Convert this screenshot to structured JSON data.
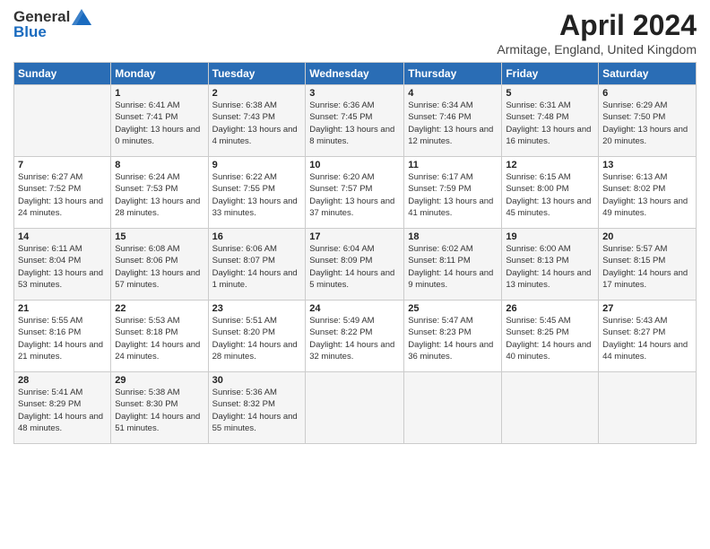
{
  "header": {
    "logo_general": "General",
    "logo_blue": "Blue",
    "month_year": "April 2024",
    "location": "Armitage, England, United Kingdom"
  },
  "days_of_week": [
    "Sunday",
    "Monday",
    "Tuesday",
    "Wednesday",
    "Thursday",
    "Friday",
    "Saturday"
  ],
  "weeks": [
    [
      {
        "day": "",
        "sunrise": "",
        "sunset": "",
        "daylight": ""
      },
      {
        "day": "1",
        "sunrise": "Sunrise: 6:41 AM",
        "sunset": "Sunset: 7:41 PM",
        "daylight": "Daylight: 13 hours and 0 minutes."
      },
      {
        "day": "2",
        "sunrise": "Sunrise: 6:38 AM",
        "sunset": "Sunset: 7:43 PM",
        "daylight": "Daylight: 13 hours and 4 minutes."
      },
      {
        "day": "3",
        "sunrise": "Sunrise: 6:36 AM",
        "sunset": "Sunset: 7:45 PM",
        "daylight": "Daylight: 13 hours and 8 minutes."
      },
      {
        "day": "4",
        "sunrise": "Sunrise: 6:34 AM",
        "sunset": "Sunset: 7:46 PM",
        "daylight": "Daylight: 13 hours and 12 minutes."
      },
      {
        "day": "5",
        "sunrise": "Sunrise: 6:31 AM",
        "sunset": "Sunset: 7:48 PM",
        "daylight": "Daylight: 13 hours and 16 minutes."
      },
      {
        "day": "6",
        "sunrise": "Sunrise: 6:29 AM",
        "sunset": "Sunset: 7:50 PM",
        "daylight": "Daylight: 13 hours and 20 minutes."
      }
    ],
    [
      {
        "day": "7",
        "sunrise": "Sunrise: 6:27 AM",
        "sunset": "Sunset: 7:52 PM",
        "daylight": "Daylight: 13 hours and 24 minutes."
      },
      {
        "day": "8",
        "sunrise": "Sunrise: 6:24 AM",
        "sunset": "Sunset: 7:53 PM",
        "daylight": "Daylight: 13 hours and 28 minutes."
      },
      {
        "day": "9",
        "sunrise": "Sunrise: 6:22 AM",
        "sunset": "Sunset: 7:55 PM",
        "daylight": "Daylight: 13 hours and 33 minutes."
      },
      {
        "day": "10",
        "sunrise": "Sunrise: 6:20 AM",
        "sunset": "Sunset: 7:57 PM",
        "daylight": "Daylight: 13 hours and 37 minutes."
      },
      {
        "day": "11",
        "sunrise": "Sunrise: 6:17 AM",
        "sunset": "Sunset: 7:59 PM",
        "daylight": "Daylight: 13 hours and 41 minutes."
      },
      {
        "day": "12",
        "sunrise": "Sunrise: 6:15 AM",
        "sunset": "Sunset: 8:00 PM",
        "daylight": "Daylight: 13 hours and 45 minutes."
      },
      {
        "day": "13",
        "sunrise": "Sunrise: 6:13 AM",
        "sunset": "Sunset: 8:02 PM",
        "daylight": "Daylight: 13 hours and 49 minutes."
      }
    ],
    [
      {
        "day": "14",
        "sunrise": "Sunrise: 6:11 AM",
        "sunset": "Sunset: 8:04 PM",
        "daylight": "Daylight: 13 hours and 53 minutes."
      },
      {
        "day": "15",
        "sunrise": "Sunrise: 6:08 AM",
        "sunset": "Sunset: 8:06 PM",
        "daylight": "Daylight: 13 hours and 57 minutes."
      },
      {
        "day": "16",
        "sunrise": "Sunrise: 6:06 AM",
        "sunset": "Sunset: 8:07 PM",
        "daylight": "Daylight: 14 hours and 1 minute."
      },
      {
        "day": "17",
        "sunrise": "Sunrise: 6:04 AM",
        "sunset": "Sunset: 8:09 PM",
        "daylight": "Daylight: 14 hours and 5 minutes."
      },
      {
        "day": "18",
        "sunrise": "Sunrise: 6:02 AM",
        "sunset": "Sunset: 8:11 PM",
        "daylight": "Daylight: 14 hours and 9 minutes."
      },
      {
        "day": "19",
        "sunrise": "Sunrise: 6:00 AM",
        "sunset": "Sunset: 8:13 PM",
        "daylight": "Daylight: 14 hours and 13 minutes."
      },
      {
        "day": "20",
        "sunrise": "Sunrise: 5:57 AM",
        "sunset": "Sunset: 8:15 PM",
        "daylight": "Daylight: 14 hours and 17 minutes."
      }
    ],
    [
      {
        "day": "21",
        "sunrise": "Sunrise: 5:55 AM",
        "sunset": "Sunset: 8:16 PM",
        "daylight": "Daylight: 14 hours and 21 minutes."
      },
      {
        "day": "22",
        "sunrise": "Sunrise: 5:53 AM",
        "sunset": "Sunset: 8:18 PM",
        "daylight": "Daylight: 14 hours and 24 minutes."
      },
      {
        "day": "23",
        "sunrise": "Sunrise: 5:51 AM",
        "sunset": "Sunset: 8:20 PM",
        "daylight": "Daylight: 14 hours and 28 minutes."
      },
      {
        "day": "24",
        "sunrise": "Sunrise: 5:49 AM",
        "sunset": "Sunset: 8:22 PM",
        "daylight": "Daylight: 14 hours and 32 minutes."
      },
      {
        "day": "25",
        "sunrise": "Sunrise: 5:47 AM",
        "sunset": "Sunset: 8:23 PM",
        "daylight": "Daylight: 14 hours and 36 minutes."
      },
      {
        "day": "26",
        "sunrise": "Sunrise: 5:45 AM",
        "sunset": "Sunset: 8:25 PM",
        "daylight": "Daylight: 14 hours and 40 minutes."
      },
      {
        "day": "27",
        "sunrise": "Sunrise: 5:43 AM",
        "sunset": "Sunset: 8:27 PM",
        "daylight": "Daylight: 14 hours and 44 minutes."
      }
    ],
    [
      {
        "day": "28",
        "sunrise": "Sunrise: 5:41 AM",
        "sunset": "Sunset: 8:29 PM",
        "daylight": "Daylight: 14 hours and 48 minutes."
      },
      {
        "day": "29",
        "sunrise": "Sunrise: 5:38 AM",
        "sunset": "Sunset: 8:30 PM",
        "daylight": "Daylight: 14 hours and 51 minutes."
      },
      {
        "day": "30",
        "sunrise": "Sunrise: 5:36 AM",
        "sunset": "Sunset: 8:32 PM",
        "daylight": "Daylight: 14 hours and 55 minutes."
      },
      {
        "day": "",
        "sunrise": "",
        "sunset": "",
        "daylight": ""
      },
      {
        "day": "",
        "sunrise": "",
        "sunset": "",
        "daylight": ""
      },
      {
        "day": "",
        "sunrise": "",
        "sunset": "",
        "daylight": ""
      },
      {
        "day": "",
        "sunrise": "",
        "sunset": "",
        "daylight": ""
      }
    ]
  ]
}
